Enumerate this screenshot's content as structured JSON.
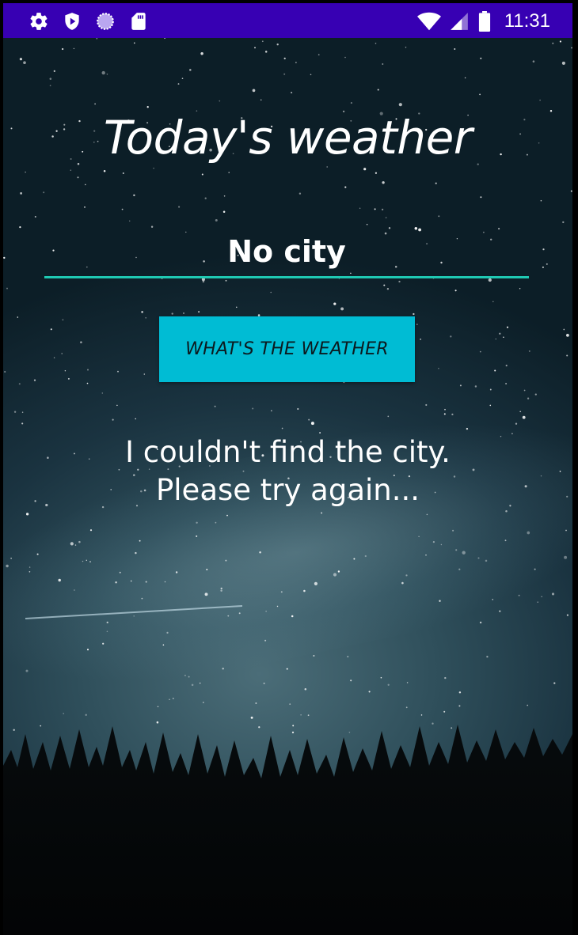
{
  "status_bar": {
    "time": "11:31",
    "left_icons": [
      "gear-icon",
      "play-protect-icon",
      "sync-circle-icon",
      "sd-card-icon"
    ],
    "right_icons": [
      "wifi-icon",
      "cell-signal-icon",
      "battery-icon"
    ],
    "background_color": "#3700b3"
  },
  "app": {
    "title": "Today's weather",
    "city_input": {
      "value": "No city",
      "underline_color": "#1fc9b3"
    },
    "button": {
      "label": "WHAT'S THE WEATHER",
      "color": "#00bcd4"
    },
    "result": {
      "line1": "I couldn't find the city.",
      "line2": "Please try again..."
    }
  }
}
